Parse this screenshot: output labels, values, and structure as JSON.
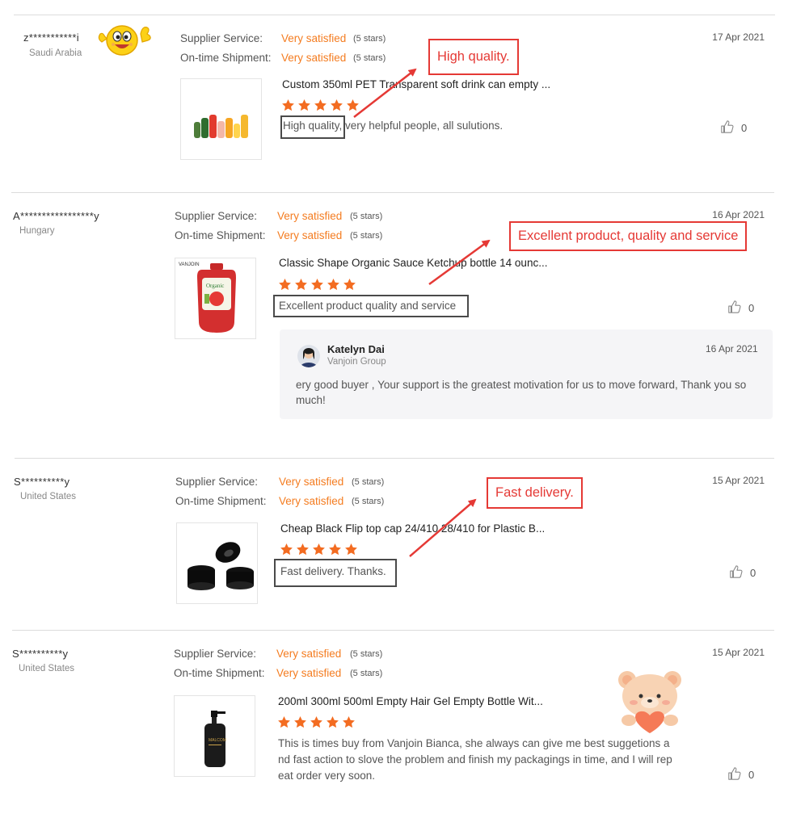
{
  "reviews": [
    {
      "buyer": "z***********i",
      "country": "Saudi Arabia",
      "supplier_label": "Supplier Service:",
      "supplier_value": "Very satisfied",
      "supplier_stars": "(5 stars)",
      "shipment_label": "On-time Shipment:",
      "shipment_value": "Very satisfied",
      "shipment_stars": "(5 stars)",
      "date": "17 Apr 2021",
      "product_title": "Custom 350ml PET Transparent soft drink can empty ...",
      "rating": 5,
      "comment": "High quality, very helpful people, all sulutions.",
      "likes": "0",
      "annotation": "High quality."
    },
    {
      "buyer": "A*****************y",
      "country": "Hungary",
      "supplier_label": "Supplier Service:",
      "supplier_value": "Very satisfied",
      "supplier_stars": "(5 stars)",
      "shipment_label": "On-time Shipment:",
      "shipment_value": "Very satisfied",
      "shipment_stars": "(5 stars)",
      "date": "16 Apr 2021",
      "product_title": "Classic Shape Organic Sauce Ketchup bottle 14 ounc...",
      "rating": 5,
      "comment": "Excellent product quality and service",
      "likes": "0",
      "annotation": "Excellent product, quality and service",
      "reply": {
        "name": "Katelyn Dai",
        "company": "Vanjoin Group",
        "date": "16 Apr 2021",
        "text": "ery good buyer , Your support is the greatest motivation for us to move forward, Thank you so much!"
      }
    },
    {
      "buyer": "S**********y",
      "country": "United States",
      "supplier_label": "Supplier Service:",
      "supplier_value": "Very satisfied",
      "supplier_stars": "(5 stars)",
      "shipment_label": "On-time Shipment:",
      "shipment_value": "Very satisfied",
      "shipment_stars": "(5 stars)",
      "date": "15 Apr 2021",
      "product_title": "Cheap Black Flip top cap 24/410 28/410 for Plastic B...",
      "rating": 5,
      "comment": "Fast delivery. Thanks.",
      "likes": "0",
      "annotation": "Fast delivery."
    },
    {
      "buyer": "S**********y",
      "country": "United States",
      "supplier_label": "Supplier Service:",
      "supplier_value": "Very satisfied",
      "supplier_stars": "(5 stars)",
      "shipment_label": "On-time Shipment:",
      "shipment_value": "Very satisfied",
      "shipment_stars": "(5 stars)",
      "date": "15 Apr 2021",
      "product_title": "200ml 300ml 500ml Empty Hair Gel Empty Bottle Wit...",
      "rating": 5,
      "comment_lines": [
        "This is times buy from Vanjoin Bianca, she always can give me best suggetions a",
        "nd fast action to slove the problem and finish my packagings in time, and I will rep",
        "eat order very soon."
      ],
      "likes": "0"
    }
  ],
  "colors": {
    "accent_orange": "#f47c20",
    "annotation_red": "#e53935",
    "star_orange": "#f36c21"
  },
  "icons": [
    "smiley-thumbs-up-emoji",
    "like-thumb-icon",
    "star-icon",
    "bear-heart-sticker",
    "avatar-icon"
  ]
}
